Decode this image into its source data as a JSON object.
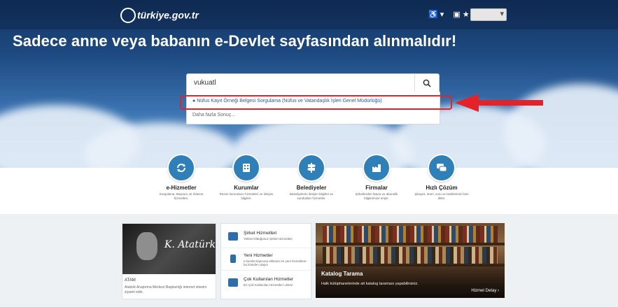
{
  "header": {
    "logo_text": "türkiye.gov.tr",
    "accessibility_icon": "accessibility-icon",
    "settings_icon": "display-settings-icon",
    "language_value": ""
  },
  "hero": {
    "headline": "Sadece anne veya babanın e-Devlet sayfasından alınmalıdır!"
  },
  "search": {
    "value": "vukuatl",
    "icon": "search-icon",
    "suggestion": "Nüfus Kayıt Örneği Belgesi Sorgulama (Nüfus ve Vatandaşlık İşleri Genel Müdürlüğü)",
    "more": "Daha fazla Sonuç..."
  },
  "annotation": {
    "highlight_color": "#e3222a",
    "arrow_color": "#e3222a"
  },
  "services": [
    {
      "title": "e-Hizmetler",
      "desc": "Sorgulama, Başvuru ve Ödeme hizmetleri.",
      "icon": "refresh-icon"
    },
    {
      "title": "Kurumlar",
      "desc": "Resmi kurumların hizmetleri ve iletişim bilgileri.",
      "icon": "building-icon"
    },
    {
      "title": "Belediyeler",
      "desc": "Belediyelerin iletişim bilgileri ve sundukları hizmetler.",
      "icon": "signpost-icon"
    },
    {
      "title": "Firmalar",
      "desc": "Şirketlerden fatura ve abonelik bilgilerinize erişin.",
      "icon": "factory-icon"
    },
    {
      "title": "Hızlı Çözüm",
      "desc": "Şikayet, öneri, soru ve isteklerinizi bize iletin.",
      "icon": "chat-icon"
    }
  ],
  "atam": {
    "title": "ATAM",
    "desc": "Atatürk Araştırma Merkezi Başkanlığı internet sitesini ziyaret edin.",
    "signature": "K. Atatürk"
  },
  "list_card": [
    {
      "title": "Şirket Hizmetleri",
      "desc": "Yetkisi Olduğunuz Şirket Hizmetleri",
      "icon": "briefcase-icon"
    },
    {
      "title": "Yeni Hizmetler",
      "desc": "e-Devlet kapısına eklenen en yeni hizmetlere bu listeden ulaşın",
      "icon": "pin-icon"
    },
    {
      "title": "Çok Kullanılan Hizmetler",
      "desc": "En Çok Kullanılan Hizmetler Listesi",
      "icon": "list-icon"
    }
  ],
  "katalog": {
    "title": "Katalog Tarama",
    "desc": "Halk kütüphanelerinde ait katalog taraması yapabilirsiniz.",
    "more": "Hizmet Detay"
  },
  "colors": {
    "accent": "#2f7fb8",
    "hero_dark": "#12325e"
  }
}
